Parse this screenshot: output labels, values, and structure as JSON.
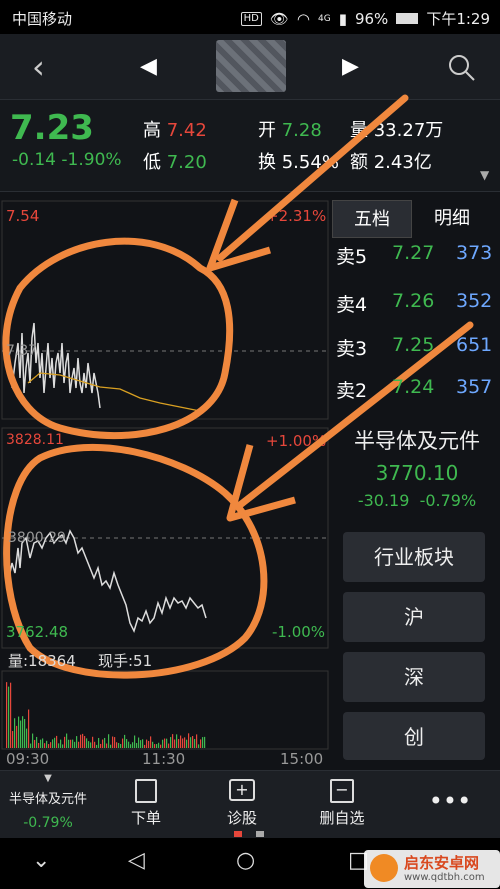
{
  "status_bar": {
    "carrier": "中国移动",
    "hd": "HD",
    "signal": "4G",
    "battery": "96%",
    "time": "下午1:29"
  },
  "header": {
    "title": "• •"
  },
  "quote": {
    "price": "7.23",
    "change": "-0.14",
    "change_pct": "-1.90%",
    "high_label": "高",
    "high": "7.42",
    "low_label": "低",
    "low": "7.20",
    "open_label": "开",
    "open": "7.28",
    "turnover_label": "换",
    "turnover": "5.54%",
    "volume_label": "量",
    "volume": "33.27万",
    "amount_label": "额",
    "amount": "2.43亿"
  },
  "stock_chart": {
    "top_left": "7.54",
    "top_right": "+2.31%",
    "mid": "7.37",
    "bottom_left": "3828.11"
  },
  "index_chart": {
    "top_right": "+1.00%",
    "mid": "3800.29",
    "bottom_left": "3762.48",
    "bottom_right": "-1.00%",
    "volume_text": "量:18364",
    "current_hand": "现手:51"
  },
  "time_axis": {
    "start": "09:30",
    "mid": "11:30",
    "end": "15:00"
  },
  "order_book": {
    "tabs": [
      "五档",
      "明细"
    ],
    "rows": [
      {
        "label": "卖5",
        "price": "7.27",
        "qty": "373"
      },
      {
        "label": "卖4",
        "price": "7.26",
        "qty": "352"
      },
      {
        "label": "卖3",
        "price": "7.25",
        "qty": "651"
      },
      {
        "label": "卖2",
        "price": "7.24",
        "qty": "357"
      }
    ]
  },
  "sector": {
    "name": "半导体及元件",
    "value": "3770.10",
    "change": "-30.19",
    "change_pct": "-0.79%",
    "buttons": [
      "行业板块",
      "沪",
      "深",
      "创"
    ]
  },
  "bottom_nav": {
    "sector_label": "半导体及元件",
    "sector_pct": "-0.79%",
    "items": [
      "下单",
      "诊股",
      "删自选"
    ]
  },
  "watermark": {
    "brand": "启东安卓网",
    "url": "www.qdtbh.com"
  },
  "colors": {
    "up": "#e6473b",
    "down": "#3fb950",
    "annotation": "#f0883e"
  }
}
